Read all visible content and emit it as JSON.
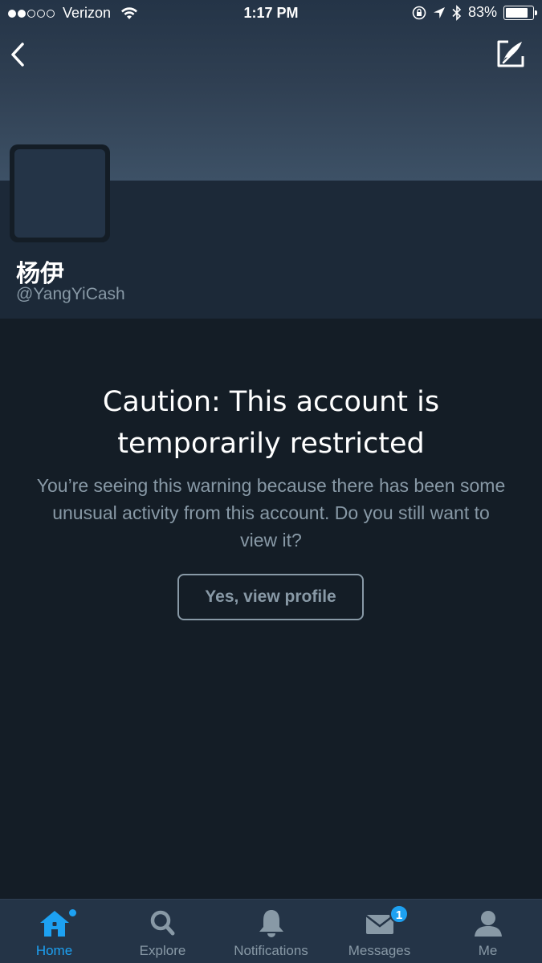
{
  "status_bar": {
    "carrier": "Verizon",
    "time": "1:17 PM",
    "battery_percent": "83%",
    "battery_level": 0.83,
    "signal_bars_filled": 2,
    "signal_bars_total": 5
  },
  "header": {
    "back_icon": "chevron-left-icon",
    "compose_icon": "compose-tweet-icon"
  },
  "profile": {
    "display_name": "杨伊",
    "handle": "@YangYiCash"
  },
  "caution": {
    "title": "Caution: This account is temporarily restricted",
    "body": "You’re seeing this warning because there has been some unusual activity from this account. Do you still want to view it?",
    "button_label": "Yes, view profile"
  },
  "tabbar": {
    "tabs": [
      {
        "label": "Home",
        "icon": "home-icon",
        "active": true
      },
      {
        "label": "Explore",
        "icon": "search-icon",
        "active": false
      },
      {
        "label": "Notifications",
        "icon": "bell-icon",
        "active": false
      },
      {
        "label": "Messages",
        "icon": "envelope-icon",
        "active": false,
        "badge": "1"
      },
      {
        "label": "Me",
        "icon": "person-icon",
        "active": false
      }
    ]
  },
  "colors": {
    "accent": "#1da1f2",
    "background": "#141d26",
    "muted_text": "#8899a6"
  }
}
